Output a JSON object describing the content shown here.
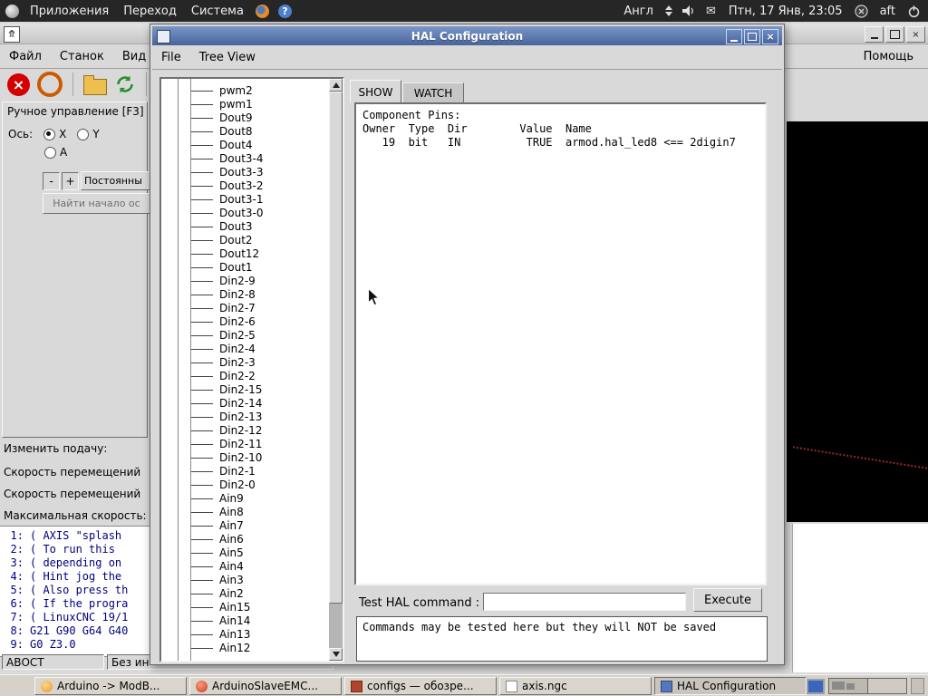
{
  "colors": {
    "top_panel_bg": "#262626",
    "window_gray": "#d9d9d9",
    "hal_titlebar_top": "#7a97c9",
    "hal_titlebar_bottom": "#48649b",
    "estop_red": "#d40000",
    "machine_power_orange": "#cc5a00",
    "gcode_text_navy": "#000080",
    "preview_bg": "#000000",
    "preview_path_red": "#b03030",
    "taskbar_bg": "#d6d2ca"
  },
  "top_panel": {
    "menus": [
      {
        "label": "Приложения"
      },
      {
        "label": "Переход"
      },
      {
        "label": "Система"
      }
    ],
    "keyboard_layout": "Англ",
    "clock": "Птн, 17 Янв, 23:05",
    "user": "aft"
  },
  "axis_window": {
    "menu_items": [
      {
        "label": "Файл"
      },
      {
        "label": "Станок"
      },
      {
        "label": "Вид"
      }
    ],
    "help_menu": "Помощь",
    "manual_tab": "Ручное управление [F3]",
    "axis_label": "Ось:",
    "axis_options": [
      "X",
      "Y",
      "A"
    ],
    "jog_minus": "-",
    "jog_plus": "+",
    "jog_mode": "Постоянны",
    "home_button": "Найти начало ос",
    "override_labels": [
      "Изменить подачу:",
      "Скорость перемещений",
      "Скорость перемещений",
      "Максимальная скорость:"
    ],
    "gcode_lines": [
      {
        "num": "1:",
        "text": "( AXIS \"splash"
      },
      {
        "num": "2:",
        "text": "( To run this "
      },
      {
        "num": "3:",
        "text": "( depending on"
      },
      {
        "num": "4:",
        "text": "( Hint jog the"
      },
      {
        "num": "5:",
        "text": "( Also press th"
      },
      {
        "num": "6:",
        "text": "( If the progra"
      },
      {
        "num": "7:",
        "text": "( LinuxCNC 19/1"
      },
      {
        "num": "8:",
        "text": "G21 G90 G64 G40"
      },
      {
        "num": "9:",
        "text": "G0 Z3.0"
      }
    ],
    "status_cells": [
      "АВОСТ",
      "Без ин"
    ]
  },
  "hal_window": {
    "title": "HAL Configuration",
    "menu_items": [
      {
        "label": "File"
      },
      {
        "label": "Tree View"
      }
    ],
    "tabs": [
      "SHOW",
      "WATCH"
    ],
    "tree_items": [
      "pwm2",
      "pwm1",
      "Dout9",
      "Dout8",
      "Dout4",
      "Dout3-4",
      "Dout3-3",
      "Dout3-2",
      "Dout3-1",
      "Dout3-0",
      "Dout3",
      "Dout2",
      "Dout12",
      "Dout1",
      "Din2-9",
      "Din2-8",
      "Din2-7",
      "Din2-6",
      "Din2-5",
      "Din2-4",
      "Din2-3",
      "Din2-2",
      "Din2-15",
      "Din2-14",
      "Din2-13",
      "Din2-12",
      "Din2-11",
      "Din2-10",
      "Din2-1",
      "Din2-0",
      "Ain9",
      "Ain8",
      "Ain7",
      "Ain6",
      "Ain5",
      "Ain4",
      "Ain3",
      "Ain2",
      "Ain15",
      "Ain14",
      "Ain13",
      "Ain12"
    ],
    "show_lines": [
      "Component Pins:",
      "Owner  Type  Dir        Value  Name",
      "   19  bit   IN          TRUE  armod.hal_led8 <== 2digin7"
    ],
    "test_command_label": "Test HAL command :",
    "test_command_value": "",
    "execute_button": "Execute",
    "note_text": "Commands may be tested here but they will NOT be saved"
  },
  "taskbar": {
    "buttons": [
      {
        "label": "Arduino -> ModB..."
      },
      {
        "label": "ArduinoSlaveEMC..."
      },
      {
        "label": "configs — обозре..."
      },
      {
        "label": "axis.ngc"
      },
      {
        "label": "HAL Configuration",
        "active": true
      }
    ]
  }
}
